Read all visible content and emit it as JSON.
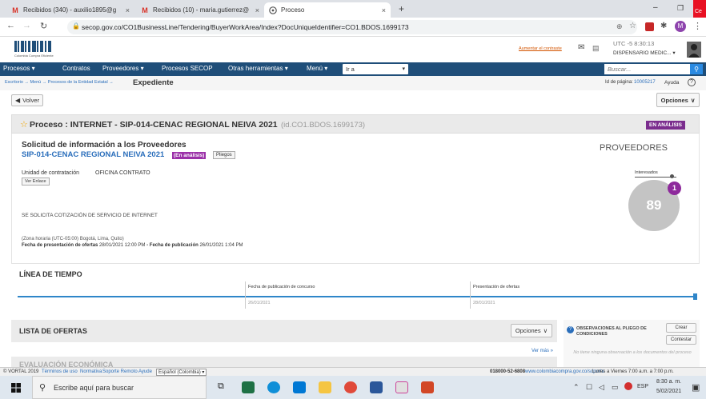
{
  "browser": {
    "tabs": [
      {
        "label": "Recibidos (340) - auxilio1895@g",
        "close": "×"
      },
      {
        "label": "Recibidos (10) - maria.gutierrez@",
        "close": "×"
      },
      {
        "label": "Proceso",
        "close": "×"
      }
    ],
    "new_tab": "+",
    "url": "secop.gov.co/CO1BusinessLine/Tendering/BuyerWorkArea/Index?DocUniqueIdentifier=CO1.BDOS.1699173",
    "window_min": "–",
    "window_max": "❐",
    "window_close_tip": "Ce"
  },
  "secop": {
    "logo_caption": "Colombia Compra Eficiente",
    "increase_contrast": "Aumentar el contraste",
    "clock": "UTC -5 8:30:13",
    "entity": "DISPENSARIO MEDIC...",
    "nav": [
      "Procesos ▾",
      "Contratos",
      "Proveedores ▾",
      "Procesos SECOP",
      "Otras herramientas ▾",
      "Menú ▾"
    ],
    "goto_value": "Ir a",
    "search_placeholder": "Buscar...",
    "breadcrumb": "Escritorio → Menú → Procesos de la Entidad Estatal →",
    "breadcrumb_current": "Expediente",
    "page_id_label": "Id de página:",
    "page_id": "10005217",
    "help": "Ayuda"
  },
  "page": {
    "back": "Volver",
    "options": "Opciones",
    "process_title": "Proceso : INTERNET - SIP-014-CENAC REGIONAL NEIVA 2021",
    "process_id": "(id.CO1.BDOS.1699173)",
    "status_badge": "EN ANÁLISIS",
    "section_title": "Solicitud de información a los Proveedores",
    "process_link": "SIP-014-CENAC REGIONAL NEIVA 2021",
    "inline_badge": "(En análisis)",
    "pliegos": "Pliegos",
    "unit_label": "Unidad de contratación",
    "unit_value": "OFICINA CONTRATO",
    "see_link": "Ver Enlace",
    "description": "SE SOLICITA COTIZACIÓN DE SERVICIO DE INTERNET",
    "timezone": "(Zona horaria (UTC-05:00) Bogotá, Lima, Quito)",
    "offer_date_label": "Fecha de presentación de ofertas",
    "offer_date": "28/01/2021 12:00 PM",
    "pub_date_label": "Fecha de publicación",
    "pub_date": "26/01/2021 1:04 PM",
    "providers_title": "PROVEEDORES",
    "interested_label": "Interesados",
    "interested_count": "1",
    "providers_total": "89"
  },
  "timeline": {
    "title": "LÍNEA DE TIEMPO",
    "events": [
      {
        "label": "Fecha de publicación de concurso",
        "date": "26/01/2021"
      },
      {
        "label": "Presentación de ofertas",
        "date": "28/01/2021"
      }
    ]
  },
  "offers": {
    "title": "LISTA DE OFERTAS",
    "options": "Opciones",
    "see_more": "Ver más »",
    "eval_title": "EVALUACIÓN ECONÓMICA"
  },
  "observations": {
    "title": "OBSERVACIONES AL PLIEGO DE CONDICIONES",
    "create": "Crear",
    "answer": "Contestar",
    "empty": "No tiene ninguna observación a los documentos del proceso"
  },
  "footer": {
    "copyright": "© VORTAL 2019",
    "links": [
      "Términos de uso",
      "Normativa",
      "Soporte Remoto",
      "Ayude"
    ],
    "language": "Español (Colombia)",
    "phone": "018000-52-6808",
    "support_url": "www.colombiacompra.gov.co/soporte",
    "hours": "Lunes a Viernes 7:00 a.m. a 7:00 p.m."
  },
  "taskbar": {
    "search_placeholder": "Escribe aquí para buscar",
    "language": "ESP",
    "time": "8:30 a. m.",
    "date": "5/02/2021"
  },
  "colors": {
    "nav_bg": "#1f4e79",
    "badge_purple": "#7b2d8e",
    "link_blue": "#2a6ebb",
    "timeline_blue": "#2f86c9"
  }
}
